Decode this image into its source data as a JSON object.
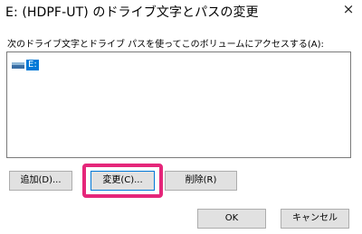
{
  "window": {
    "title": "E: (HDPF-UT) のドライブ文字とパスの変更",
    "close_glyph": "×"
  },
  "instruction": "次のドライブ文字とドライブ パスを使ってこのボリュームにアクセスする(A):",
  "list": {
    "items": [
      {
        "label": "E:",
        "icon": "drive-icon",
        "selected": true
      }
    ]
  },
  "buttons": {
    "add": "追加(D)...",
    "change": "変更(C)...",
    "remove": "削除(R)",
    "ok": "OK",
    "cancel": "キャンセル"
  },
  "colors": {
    "selection": "#0078d7",
    "highlight": "#e5267a"
  }
}
